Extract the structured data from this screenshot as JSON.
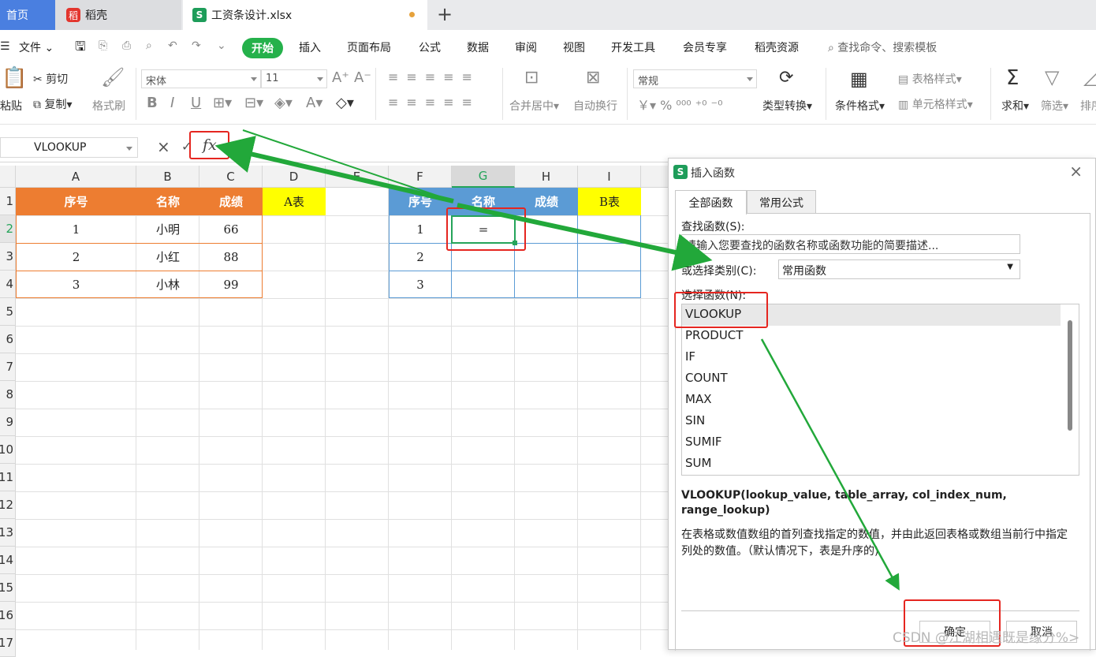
{
  "tabs": {
    "home": "首页",
    "daoke": "稻壳",
    "daoke_logo": "稻",
    "file": "工资条设计.xlsx",
    "file_logo": "S",
    "plus": "+"
  },
  "menu": {
    "file": "文件",
    "start": "开始",
    "items": [
      "插入",
      "页面布局",
      "公式",
      "数据",
      "审阅",
      "视图",
      "开发工具",
      "会员专享",
      "稻壳资源"
    ],
    "search": "查找命令、搜索模板"
  },
  "ribbon": {
    "paste": "粘贴",
    "cut": "剪切",
    "copy": "复制",
    "format_painter": "格式刷",
    "font": "宋体",
    "font_size": "11",
    "merge": "合并居中",
    "wrap": "自动换行",
    "number_format": "常规",
    "convert": "类型转换",
    "cond_format": "条件格式",
    "table_style": "表格样式",
    "cell_style": "单元格样式",
    "sum": "求和",
    "filter": "筛选",
    "sort": "排序",
    "bold": "B",
    "italic": "I",
    "underline": "U"
  },
  "formula": {
    "name_box": "VLOOKUP",
    "cancel": "×",
    "confirm": "✓",
    "fx": "fx",
    "content": "="
  },
  "grid": {
    "columns": [
      "A",
      "B",
      "C",
      "D",
      "E",
      "F",
      "G",
      "H",
      "I"
    ],
    "rows": [
      "1",
      "2",
      "3",
      "4",
      "5",
      "6",
      "7",
      "8",
      "9",
      "10",
      "11",
      "12",
      "13",
      "14",
      "15",
      "16",
      "17"
    ],
    "table_a": {
      "headers": [
        "序号",
        "名称",
        "成绩"
      ],
      "label": "A表",
      "rows": [
        [
          "1",
          "小明",
          "66"
        ],
        [
          "2",
          "小红",
          "88"
        ],
        [
          "3",
          "小林",
          "99"
        ]
      ]
    },
    "table_b": {
      "headers": [
        "序号",
        "名称",
        "成绩"
      ],
      "label": "B表",
      "ids": [
        "1",
        "2",
        "3"
      ],
      "active_value": "="
    }
  },
  "dialog": {
    "title": "插入函数",
    "close": "×",
    "logo": "S",
    "tabs": [
      "全部函数",
      "常用公式"
    ],
    "search_label": "查找函数(S):",
    "search_value": "请输入您要查找的函数名称或函数功能的简要描述...",
    "category_label": "或选择类别(C):",
    "category_value": "常用函数",
    "select_label": "选择函数(N):",
    "functions": [
      "VLOOKUP",
      "PRODUCT",
      "IF",
      "COUNT",
      "MAX",
      "SIN",
      "SUMIF",
      "SUM"
    ],
    "signature": "VLOOKUP(lookup_value, table_array, col_index_num, range_lookup)",
    "description": "在表格或数值数组的首列查找指定的数值，并由此返回表格或数组当前行中指定列处的数值。（默认情况下，表是升序的)",
    "ok": "确定",
    "cancel": "取消"
  },
  "watermark": "CSDN @江湖相遇既是缘分%>",
  "colors": {
    "green_accent": "#25b14b",
    "annotation_red": "#e52620",
    "arrow_green": "#22a83a",
    "header_orange": "#ed7d31",
    "header_blue": "#5b9bd5",
    "header_yellow": "#ffff00"
  }
}
